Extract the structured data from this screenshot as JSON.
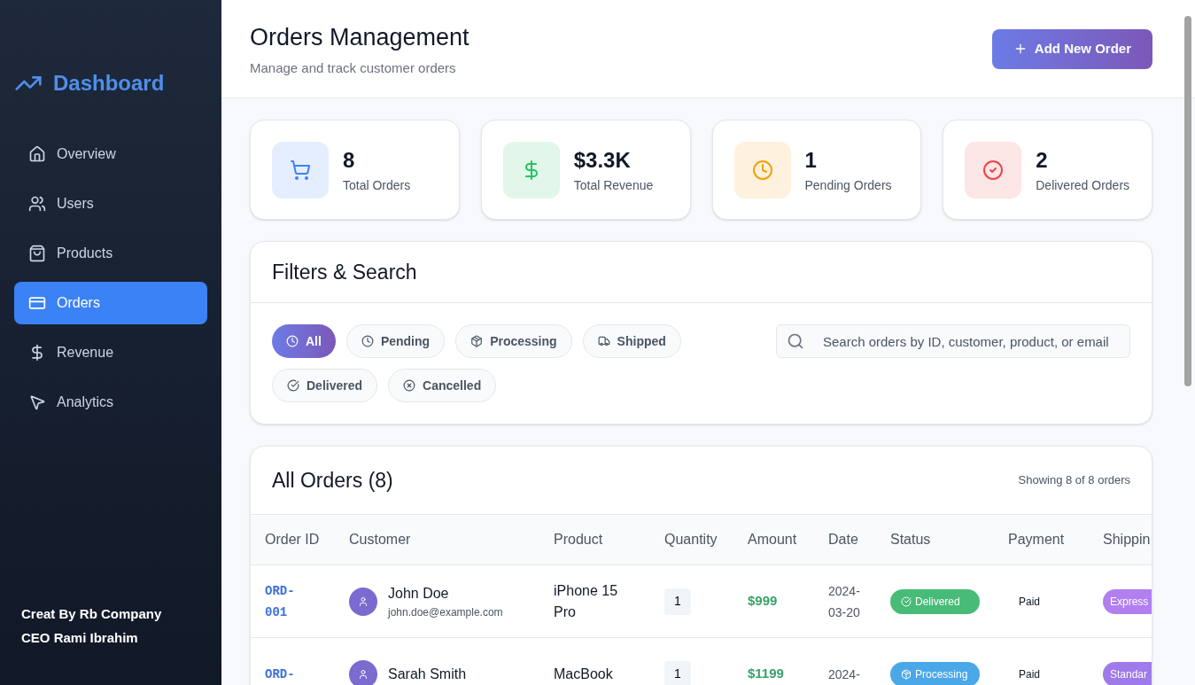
{
  "sidebar": {
    "brand": "Dashboard",
    "items": [
      {
        "label": "Overview",
        "kind": "home",
        "selected": false
      },
      {
        "label": "Users",
        "kind": "users",
        "selected": false
      },
      {
        "label": "Products",
        "kind": "bag",
        "selected": false
      },
      {
        "label": "Orders",
        "kind": "card",
        "selected": true
      },
      {
        "label": "Revenue",
        "kind": "dollar",
        "selected": false
      },
      {
        "label": "Analytics",
        "kind": "pointer",
        "selected": false
      }
    ],
    "footer": [
      "Creat By Rb Company",
      "CEO Rami Ibrahim"
    ]
  },
  "header": {
    "title": "Orders Management",
    "subtitle": "Manage and track customer orders",
    "button": "Add New Order"
  },
  "stats": [
    {
      "value": "8",
      "label": "Total Orders",
      "kind": "cart",
      "color": "#3b82f6"
    },
    {
      "value": "$3.3K",
      "label": "Total Revenue",
      "kind": "dollar",
      "color": "#22c55e"
    },
    {
      "value": "1",
      "label": "Pending Orders",
      "kind": "clock",
      "color": "#f59e0b"
    },
    {
      "value": "2",
      "label": "Delivered Orders",
      "kind": "check",
      "color": "#ef4444"
    }
  ],
  "filters": {
    "title": "Filters & Search",
    "chips": [
      {
        "label": "All",
        "kind": "clock",
        "selected": true
      },
      {
        "label": "Pending",
        "kind": "clock",
        "selected": false
      },
      {
        "label": "Processing",
        "kind": "box",
        "selected": false
      },
      {
        "label": "Shipped",
        "kind": "truck",
        "selected": false
      },
      {
        "label": "Delivered",
        "kind": "check",
        "selected": false
      },
      {
        "label": "Cancelled",
        "kind": "x",
        "selected": false
      }
    ],
    "search": {
      "placeholder": "Search orders by ID, customer, product, or email"
    }
  },
  "orders": {
    "title": "All Orders (8)",
    "showing": "Showing 8 of 8 orders",
    "columns": [
      "Order ID",
      "Customer",
      "Product",
      "Quantity",
      "Amount",
      "Date",
      "Status",
      "Payment",
      "Shippin"
    ],
    "rows": [
      {
        "id": [
          "ORD-",
          "001"
        ],
        "customer": "John Doe",
        "email": "john.doe@example.com",
        "product": [
          "iPhone 15",
          "Pro"
        ],
        "quantity": "1",
        "amount": "$999",
        "date": [
          "2024-",
          "03-20"
        ],
        "status": {
          "label": "Delivered",
          "kind": "delivered"
        },
        "payment": "Paid",
        "shipping": {
          "label": "Express",
          "kind": "express"
        }
      },
      {
        "id": [
          "ORD-"
        ],
        "customer": "Sarah Smith",
        "product": [
          "MacBook"
        ],
        "quantity": "1",
        "amount": "$1199",
        "date": [
          "2024-"
        ],
        "status": {
          "label": "Processing",
          "kind": "processing"
        },
        "payment": "Paid",
        "shipping": {
          "label": "Standar",
          "kind": "standard"
        }
      }
    ]
  }
}
